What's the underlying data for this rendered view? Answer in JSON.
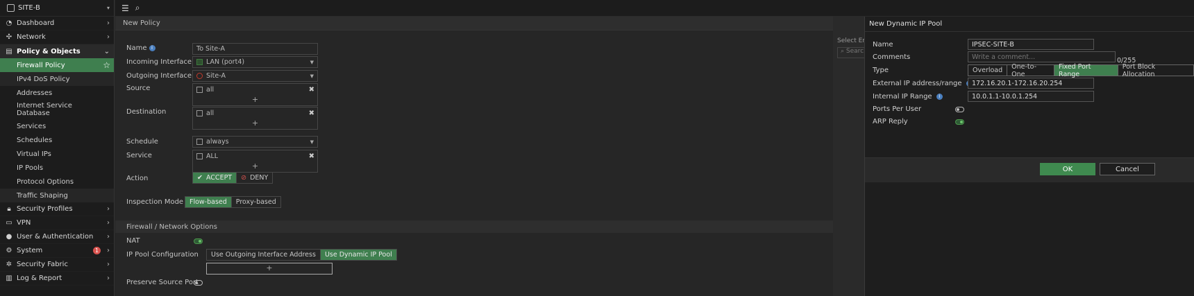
{
  "device": {
    "name": "SITE-B"
  },
  "sidebar": {
    "items": [
      {
        "label": "Dashboard",
        "icon": "dashboard-icon"
      },
      {
        "label": "Network",
        "icon": "network-icon"
      },
      {
        "label": "Policy & Objects",
        "icon": "policy-icon"
      },
      {
        "label": "Firewall Policy"
      },
      {
        "label": "IPv4 DoS Policy"
      },
      {
        "label": "Addresses"
      },
      {
        "label": "Internet Service Database"
      },
      {
        "label": "Services"
      },
      {
        "label": "Schedules"
      },
      {
        "label": "Virtual IPs"
      },
      {
        "label": "IP Pools"
      },
      {
        "label": "Protocol Options"
      },
      {
        "label": "Traffic Shaping"
      },
      {
        "label": "Security Profiles",
        "icon": "lock-icon"
      },
      {
        "label": "VPN",
        "icon": "vpn-icon"
      },
      {
        "label": "User & Authentication",
        "icon": "user-icon"
      },
      {
        "label": "System",
        "icon": "gear-icon",
        "badge": "1"
      },
      {
        "label": "Security Fabric",
        "icon": "fabric-icon"
      },
      {
        "label": "Log & Report",
        "icon": "chart-icon"
      }
    ]
  },
  "page": {
    "title": "New Policy"
  },
  "policy": {
    "name_label": "Name",
    "name_value": "To Site-A",
    "incoming_label": "Incoming Interface",
    "incoming_value": "LAN (port4)",
    "outgoing_label": "Outgoing Interface",
    "outgoing_value": "Site-A",
    "source_label": "Source",
    "source_value": "all",
    "destination_label": "Destination",
    "destination_value": "all",
    "schedule_label": "Schedule",
    "schedule_value": "always",
    "service_label": "Service",
    "service_value": "ALL",
    "action_label": "Action",
    "action_accept": "ACCEPT",
    "action_deny": "DENY",
    "inspection_label": "Inspection Mode",
    "inspection_flow": "Flow-based",
    "inspection_proxy": "Proxy-based",
    "fw_section": "Firewall / Network Options",
    "nat_label": "NAT",
    "ippool_label": "IP Pool Configuration",
    "ippool_outgoing": "Use Outgoing Interface Address",
    "ippool_dynamic": "Use Dynamic IP Pool",
    "preserve_label": "Preserve Source Port",
    "plus": "+"
  },
  "side_strip": {
    "title": "Select En",
    "search": "Search"
  },
  "panel": {
    "title": "New Dynamic IP Pool",
    "name_label": "Name",
    "name_value": "IPSEC-SITE-B",
    "comments_label": "Comments",
    "comments_placeholder": "Write a comment...",
    "comments_count": "0/255",
    "type_label": "Type",
    "type_options": [
      "Overload",
      "One-to-One",
      "Fixed Port Range",
      "Port Block Allocation"
    ],
    "type_selected": "Fixed Port Range",
    "external_label": "External IP address/range",
    "external_value": "172.16.20.1-172.16.20.254",
    "internal_label": "Internal IP Range",
    "internal_value": "10.0.1.1-10.0.1.254",
    "ports_label": "Ports Per User",
    "arp_label": "ARP Reply",
    "ok_label": "OK",
    "cancel_label": "Cancel"
  },
  "colors": {
    "accent": "#3f7f4f",
    "background": "#262626",
    "badge": "#d9534f"
  }
}
